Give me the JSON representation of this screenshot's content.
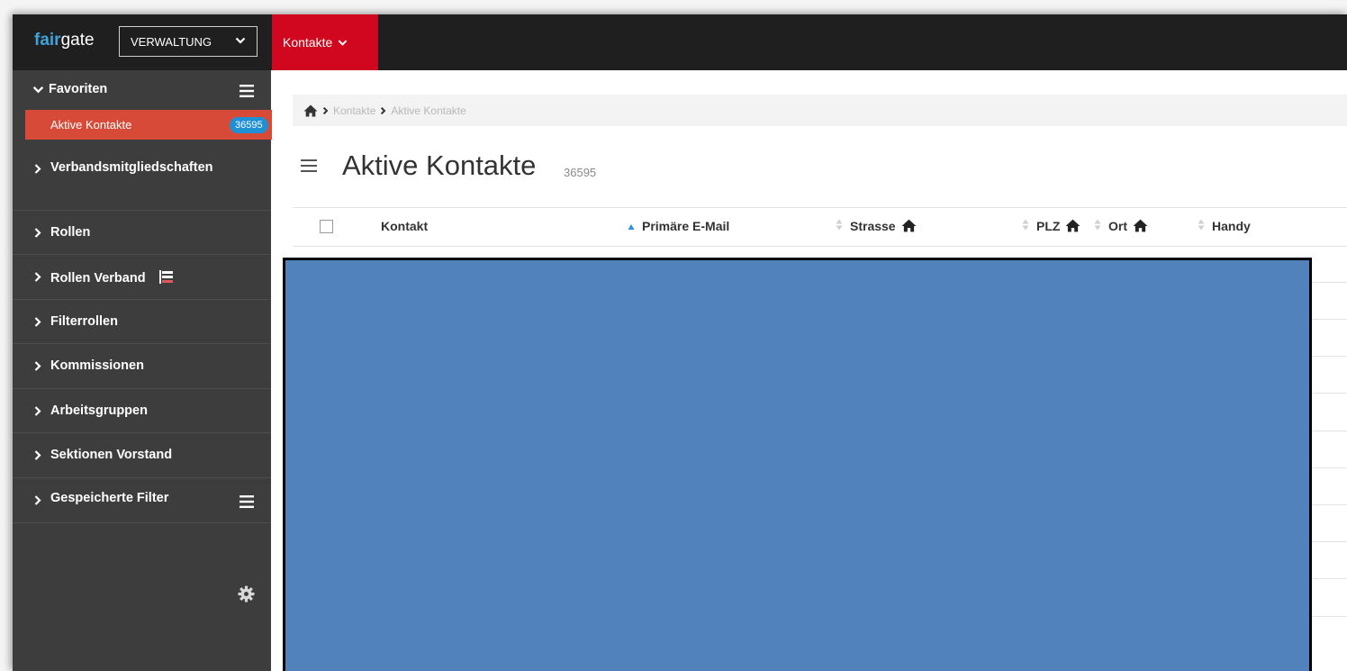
{
  "app": {
    "brand_prefix": "fair",
    "brand_suffix": "gate",
    "module_select": "VERWALTUNG",
    "module_tab": "Kontakte"
  },
  "sidebar": {
    "favorites_title": "Favoriten",
    "active_item_label": "Aktive Kontakte",
    "active_item_count": "36595",
    "items": [
      {
        "label": "Verbandsmitgliedschaften"
      },
      {
        "label": "Rollen"
      },
      {
        "label": "Rollen Verband"
      },
      {
        "label": "Filterrollen"
      },
      {
        "label": "Kommissionen"
      },
      {
        "label": "Arbeitsgruppen"
      },
      {
        "label": "Sektionen Vorstand"
      },
      {
        "label": "Gespeicherte Filter"
      }
    ]
  },
  "breadcrumb": [
    "Kontakte",
    "Aktive Kontakte"
  ],
  "page": {
    "title": "Aktive Kontakte",
    "count": "36595"
  },
  "table": {
    "columns": [
      "Kontakt",
      "Primäre E-Mail",
      "Strasse",
      "PLZ",
      "Ort",
      "Handy"
    ]
  },
  "colors": {
    "accent_red": "#d0071e",
    "sidebar_bg": "#3d3d3d",
    "active_item_bg": "#d84a38",
    "badge_blue": "#1f8fd6",
    "overlay_blue": "#5182bc"
  },
  "icons": {
    "home": "home-icon",
    "menu": "hamburger-icon",
    "settings": "gear-icon",
    "chevron": "chevron-down-icon",
    "arrow": "chevron-right-icon"
  }
}
